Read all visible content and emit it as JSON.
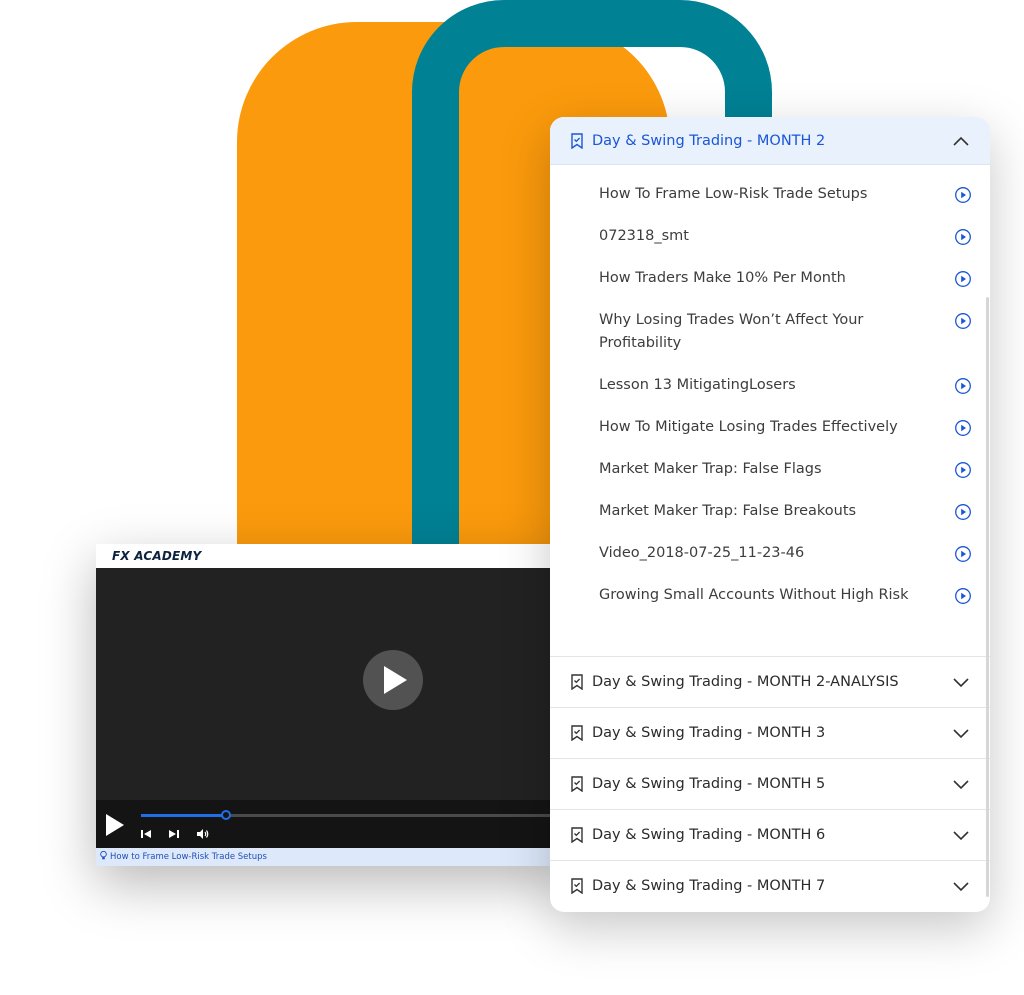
{
  "player": {
    "logo": "FX ACADEMY",
    "caption": "How to Frame Low-Risk Trade Setups",
    "progress": 0.2,
    "icons": {
      "play": "play-icon",
      "prev": "skip-back-icon",
      "next": "skip-forward-icon",
      "volume": "volume-icon",
      "caption": "lightbulb-icon"
    }
  },
  "curriculum": {
    "open_module": {
      "title": "Day & Swing Trading - MONTH 2",
      "lessons": [
        {
          "label": "How To Frame Low-Risk Trade Setups"
        },
        {
          "label": "072318_smt"
        },
        {
          "label": "How Traders Make 10% Per Month"
        },
        {
          "label": "Why Losing Trades Won’t Affect Your Profitability"
        },
        {
          "label": "Lesson 13 MitigatingLosers"
        },
        {
          "label": "How To Mitigate Losing Trades Effectively"
        },
        {
          "label": "Market Maker Trap: False Flags"
        },
        {
          "label": "Market Maker Trap: False Breakouts"
        },
        {
          "label": "Video_2018-07-25_11-23-46"
        },
        {
          "label": "Growing Small Accounts Without High Risk"
        }
      ]
    },
    "modules": [
      {
        "title": "Day & Swing Trading - MONTH 2-ANALYSIS"
      },
      {
        "title": "Day & Swing Trading - MONTH 3"
      },
      {
        "title": "Day & Swing Trading - MONTH 5"
      },
      {
        "title": "Day & Swing Trading - MONTH 6"
      },
      {
        "title": "Day & Swing Trading - MONTH 7"
      }
    ]
  },
  "colors": {
    "accent": "#1a56d6",
    "orange": "#fb9a0c",
    "teal": "#008194",
    "header_bg": "#e9f1fd"
  }
}
